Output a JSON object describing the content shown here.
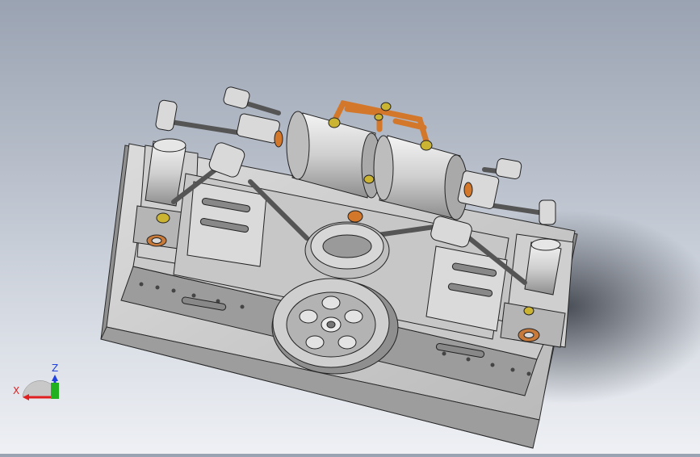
{
  "viewport": {
    "background_top": "#9aa3b2",
    "background_bottom": "#eef0f4",
    "model_color": "#d4d4d4",
    "copper_color": "#d3772a",
    "brass_color": "#cbb432"
  },
  "triad": {
    "x_label": "X",
    "z_label": "Z",
    "x_color": "#e02020",
    "y_color": "#20b020",
    "z_color": "#2040e0"
  }
}
